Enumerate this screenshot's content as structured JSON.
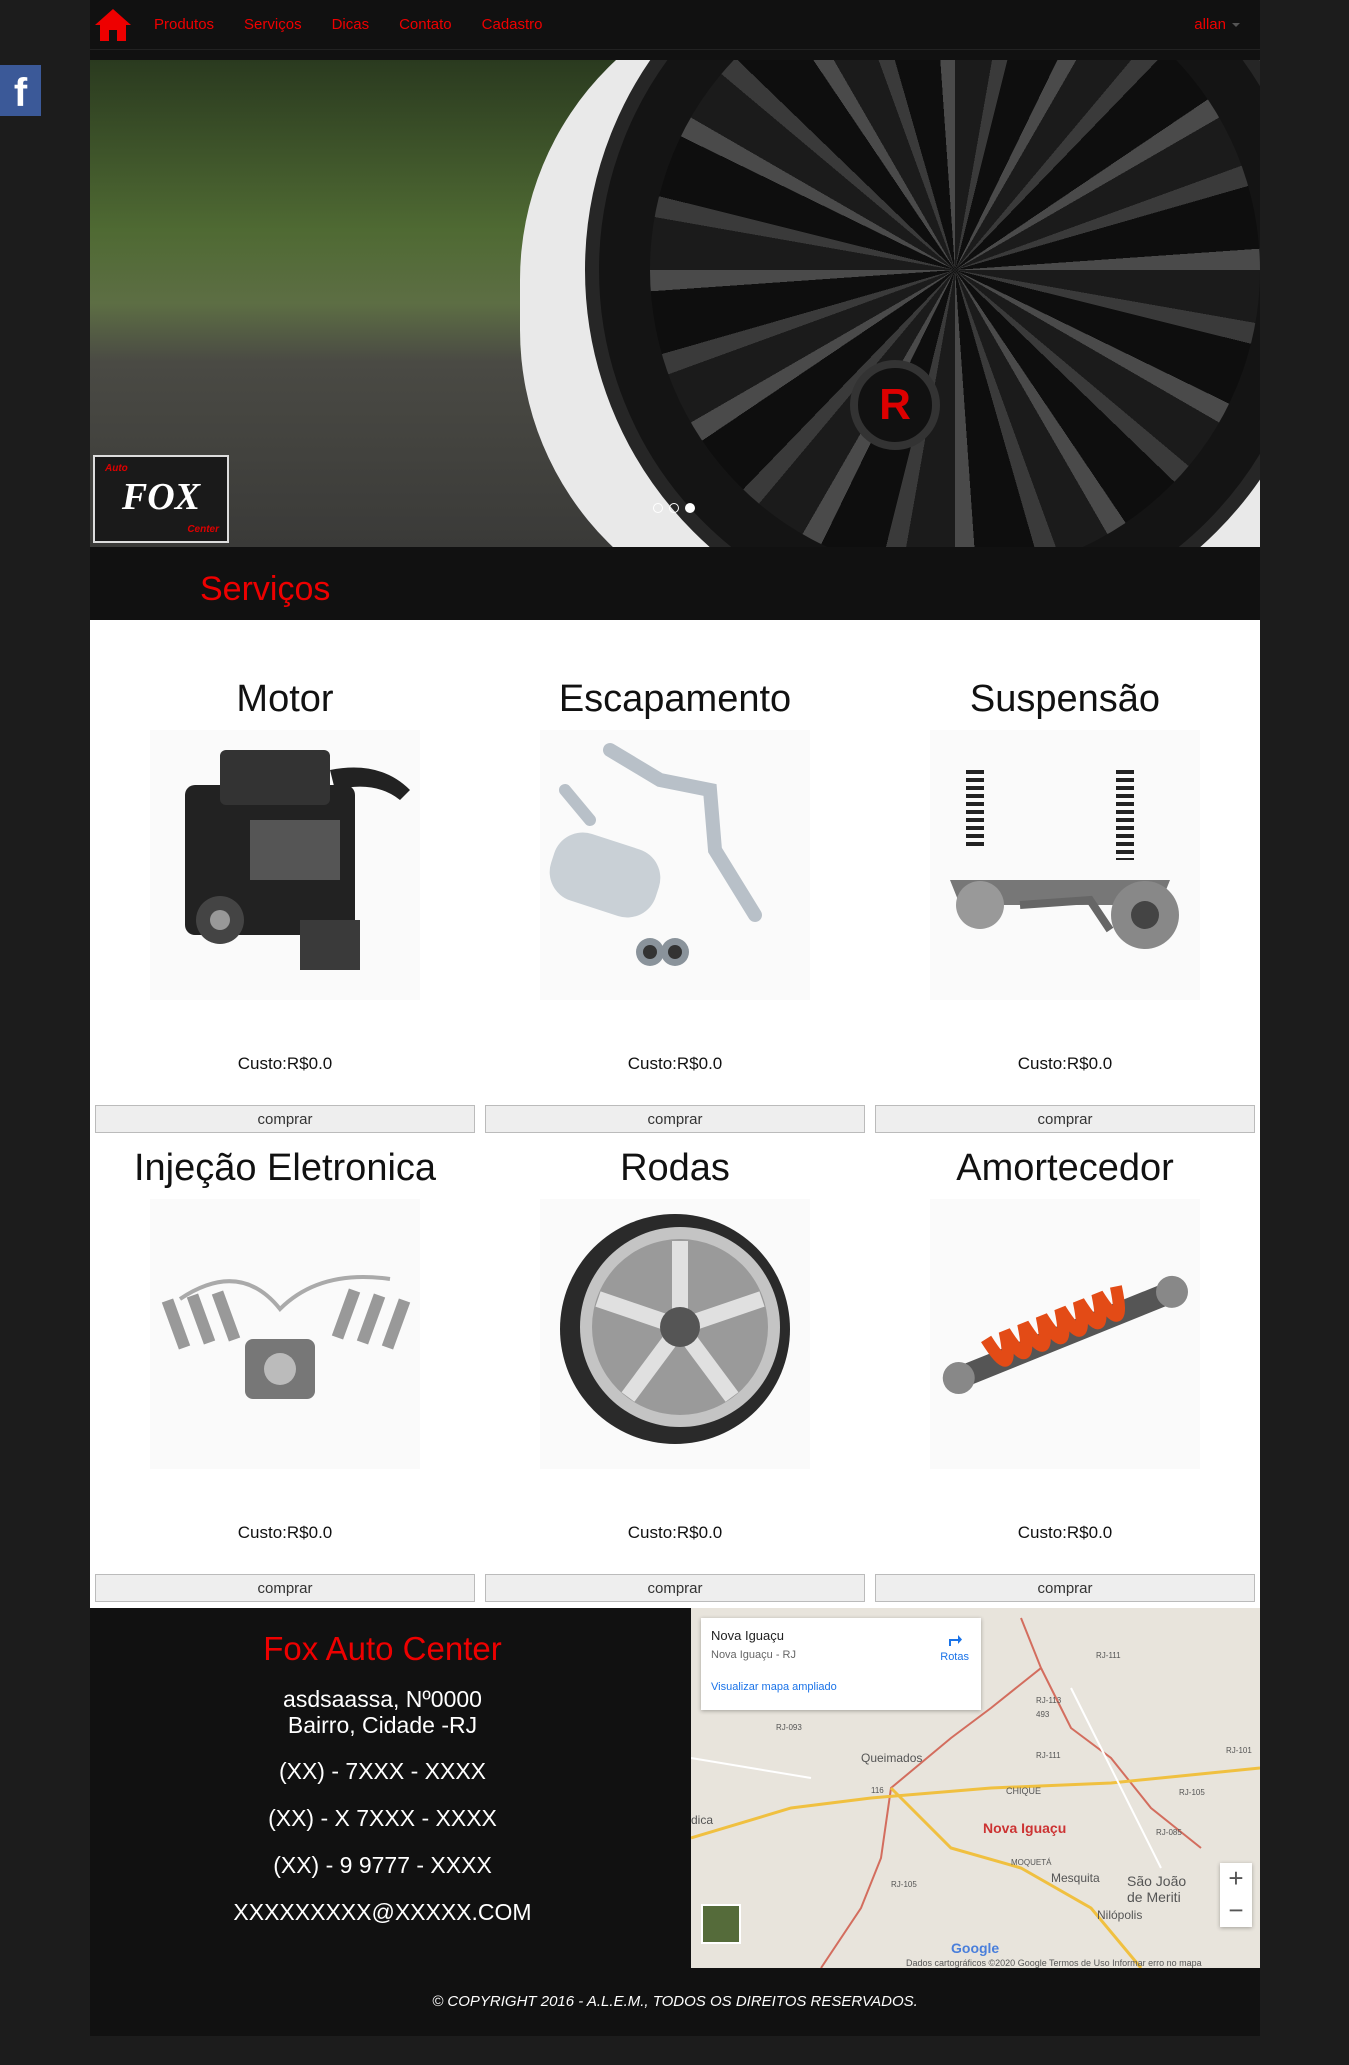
{
  "nav": {
    "items": [
      "Produtos",
      "Serviços",
      "Dicas",
      "Contato",
      "Cadastro"
    ],
    "user": "allan"
  },
  "hero": {
    "wheel_logo": "R",
    "logo_top": "Auto",
    "logo_main": "FOX",
    "logo_bottom": "Center",
    "slides": 3,
    "active_slide": 3
  },
  "section_title": "Serviços",
  "services": [
    {
      "title": "Motor",
      "price": "Custo:R$0.0",
      "button": "comprar",
      "icon": "engine-icon"
    },
    {
      "title": "Escapamento",
      "price": "Custo:R$0.0",
      "button": "comprar",
      "icon": "exhaust-icon"
    },
    {
      "title": "Suspensão",
      "price": "Custo:R$0.0",
      "button": "comprar",
      "icon": "suspension-icon"
    },
    {
      "title": "Injeção Eletronica",
      "price": "Custo:R$0.0",
      "button": "comprar",
      "icon": "injection-icon"
    },
    {
      "title": "Rodas",
      "price": "Custo:R$0.0",
      "button": "comprar",
      "icon": "wheel-icon"
    },
    {
      "title": "Amortecedor",
      "price": "Custo:R$0.0",
      "button": "comprar",
      "icon": "shock-absorber-icon"
    }
  ],
  "footer": {
    "company": "Fox Auto Center",
    "address_line1": "asdsaassa, Nº0000",
    "address_line2": "Bairro, Cidade -RJ",
    "phone1": "(XX) - 7XXX - XXXX",
    "phone2": "(XX) - X 7XXX - XXXX",
    "phone3": "(XX) - 9 9777 - XXXX",
    "email": "XXXXXXXXX@XXXXX.COM",
    "copyright": "© COPYRIGHT 2016 - A.L.E.M., TODOS OS DIREITOS RESERVADOS."
  },
  "map": {
    "place": "Nova Iguaçu",
    "place_sub": "Nova Iguaçu - RJ",
    "directions": "Rotas",
    "enlarge": "Visualizar mapa ampliado",
    "labels": {
      "queimados": "Queimados",
      "chique": "CHIQUE",
      "moqueta": "MOQUETÁ",
      "mesquita": "Mesquita",
      "sao_joao": "São João",
      "de_meriti": "de Meriti",
      "nilopolis": "Nilópolis",
      "dica": "dica"
    },
    "roads": [
      "RJ-111",
      "RJ-113",
      "493",
      "RJ-093",
      "RJ-111",
      "RJ-101",
      "116",
      "RJ-105",
      "RJ-085",
      "RJ-105"
    ],
    "city_label": "Nova Iguaçu",
    "google": "Google",
    "attribution": "Dados cartográficos ©2020 Google    Termos de Uso    Informar erro no mapa",
    "zoom_in": "+",
    "zoom_out": "−"
  },
  "colors": {
    "accent": "#e00000",
    "background": "#1c1c1c",
    "panel": "#111111"
  }
}
